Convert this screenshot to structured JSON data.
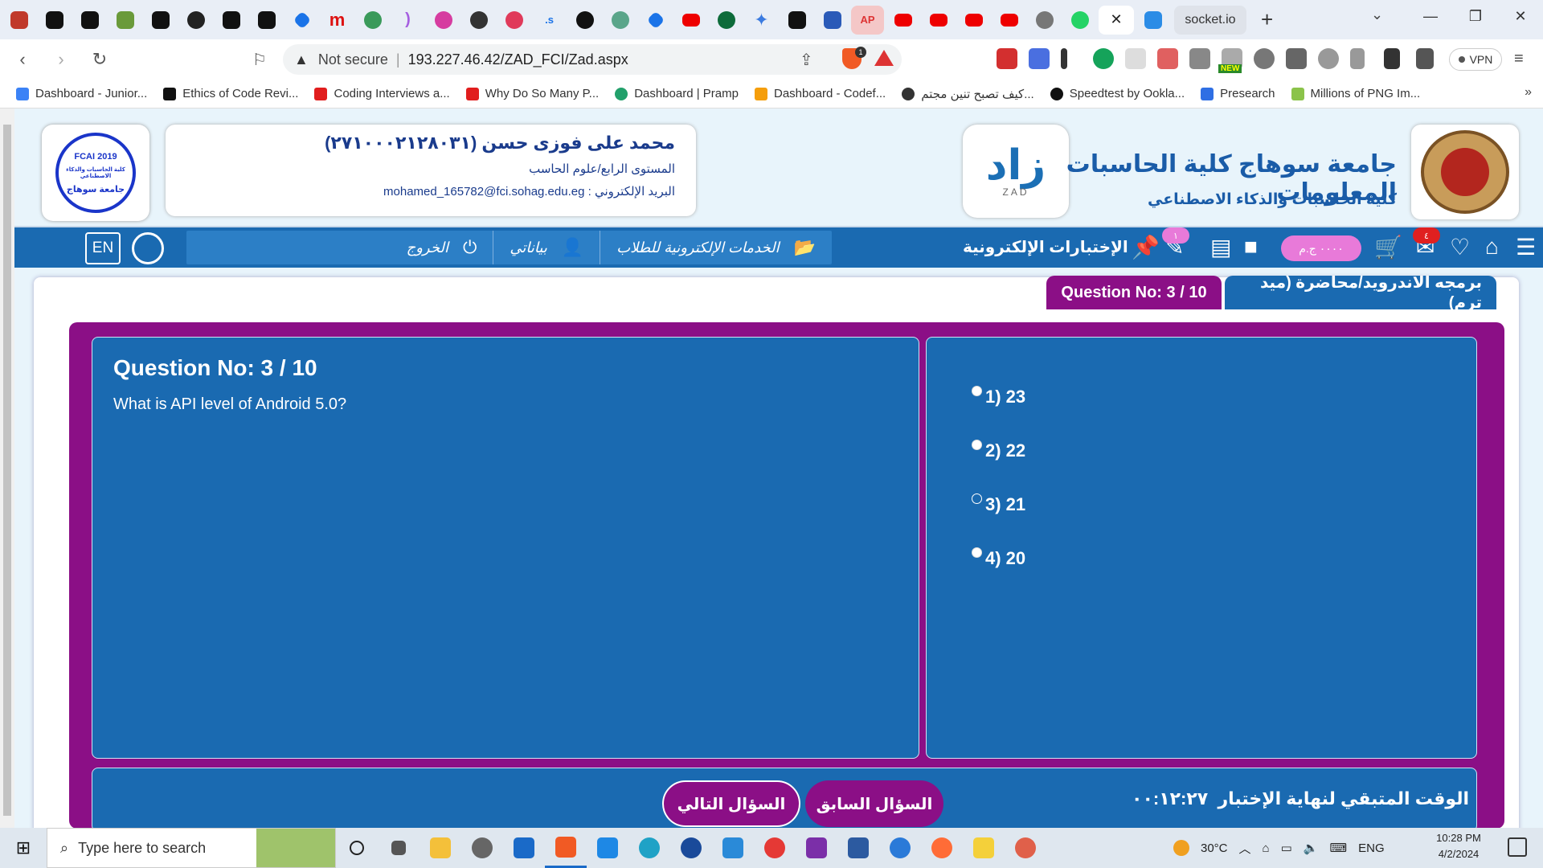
{
  "browser": {
    "active_tab_title": "socket.io",
    "tab_icons": [
      "tab-pdf-icon",
      "tab-r-icon",
      "tab-r-icon",
      "tab-puzzle-icon",
      "tab-dev-icon",
      "tab-github-icon",
      "tab-r-icon",
      "tab-dev-icon",
      "tab-diamond-icon",
      "tab-m-icon",
      "tab-bell-icon",
      "tab-paren-icon",
      "tab-star-icon",
      "tab-chatgpt-icon",
      "tab-bird-icon",
      "tab-dots-icon",
      "tab-circle-icon",
      "tab-chatgpt-icon",
      "tab-diamond-icon",
      "tab-youtube-icon",
      "tab-leaf-icon",
      "tab-sparkle-icon",
      "tab-dev-icon",
      "tab-bank-icon",
      "tab-ap-icon",
      "tab-youtube-icon",
      "tab-youtube-icon",
      "tab-youtube-icon",
      "tab-youtube-icon",
      "tab-globe-icon",
      "tab-whatsapp-icon",
      "tab-close-icon",
      "tab-video-icon"
    ],
    "ap_tab_label": "AP",
    "security_label": "Not secure",
    "url": "193.227.46.42/ZAD_FCI/Zad.aspx",
    "brave_badge": "1",
    "vpn_label": "VPN",
    "new_badge": "NEW",
    "bookmarks": [
      {
        "label": "Dashboard - Junior...",
        "color": "#3b82f6"
      },
      {
        "label": "Ethics of Code Revi...",
        "color": "#111111"
      },
      {
        "label": "Coding Interviews a...",
        "color": "#e11d1d"
      },
      {
        "label": "Why Do So Many P...",
        "color": "#e11d1d"
      },
      {
        "label": "Dashboard | Pramp",
        "color": "#22a06b"
      },
      {
        "label": "Dashboard - Codef...",
        "color": "#f59e0b"
      },
      {
        "label": "كيف تصبح تنين مجتم...",
        "color": "#333333"
      },
      {
        "label": "Speedtest by Ookla...",
        "color": "#111111"
      },
      {
        "label": "Presearch",
        "color": "#2f6fe4"
      },
      {
        "label": "Millions of PNG Im...",
        "color": "#8bc34a"
      }
    ]
  },
  "site": {
    "student_name": "محمد على فوزى حسن (٢٧١٠٠٠٢١٢٨٠٣١)",
    "level": "المستوى الرابع/علوم الحاسب",
    "email_label": "البريد الإلكتروني : mohamed_165782@fci.sohag.edu.eg",
    "zad_logo_text": "زاد",
    "zad_logo_sub": "ZAD",
    "university_title": "جامعة سوهاج كلية الحاسبات المعلومات",
    "faculty_subtitle": "كلية الحاسبات والذكاء الاصطناعي",
    "fci_logo_top": "FCAI 2019",
    "fci_logo_bottom": "جامعة سوهاج",
    "fci_logo_middle": "كلية الحاسبات والذكاء الاصطناعي"
  },
  "nav": {
    "title": "الإختبارات الإلكترونية",
    "services": "الخدمات الإلكترونية للطلاب",
    "my_data": "بياناتي",
    "logout": "الخروج",
    "lang": "EN",
    "notes_badge": "١",
    "mail_badge": "٤",
    "balance": "٠٠٠٠ ج.م"
  },
  "exam": {
    "course_tab": "برمجه الاندرويد/محاضرة (ميد ترم)",
    "qno_tab": "Question No: 3 / 10",
    "question_title": "Question No: 3 / 10",
    "question_text": "What is API level of Android 5.0?",
    "options": [
      "1) 23",
      "2) 22",
      "3) 21",
      "4) 20"
    ],
    "selected_option": 2,
    "next_label": "السؤال التالي",
    "prev_label": "السؤال السابق",
    "timer_label": "الوقت المتبقي لنهاية الإختبار",
    "timer_value": "٠٠:١٢:٢٧"
  },
  "taskbar": {
    "search_placeholder": "Type here to search",
    "temperature": "30°C",
    "lang": "ENG",
    "time": "10:28 PM",
    "date": "4/2/2024"
  }
}
